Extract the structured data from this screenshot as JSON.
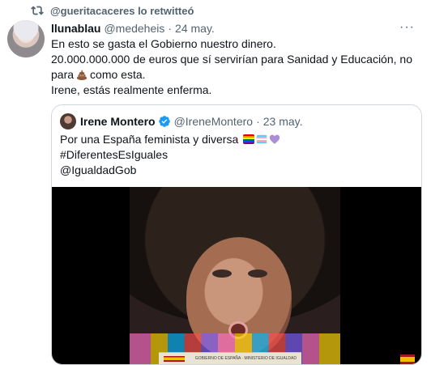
{
  "retweet": {
    "text": "@gueritacaceres lo retwitteó",
    "icon": "retweet-icon"
  },
  "tweet": {
    "name": "llunablau",
    "handle": "@medeheis",
    "separator": "·",
    "date": "24 may.",
    "more_label": "···",
    "lines": [
      "En esto se gasta el Gobierno nuestro dinero.",
      "20.000.000.000 de euros que sí servirían para Sanidad y Educación, no",
      "como esta.",
      "Irene, estás realmente enferma."
    ],
    "line3_prefix": "para",
    "emoji": "pile-of-poo-icon"
  },
  "quote": {
    "name": "Irene Montero",
    "handle": "@IreneMontero",
    "separator": "·",
    "date": "23 may.",
    "lines": [
      "Por una España feminista y diversa",
      "#DiferentesEsIguales",
      "@IgualdadGob"
    ],
    "icons": [
      "verified-badge-icon",
      "rainbow-flag-icon",
      "transgender-flag-icon",
      "purple-heart-icon"
    ]
  },
  "video": {
    "caption_text": "GOBIERNO DE ESPAÑA · MINISTERIO DE IGUALDAD"
  },
  "colors": {
    "accent": "#1d9bf0",
    "secondary": "#536471",
    "border": "#cfd9de"
  }
}
